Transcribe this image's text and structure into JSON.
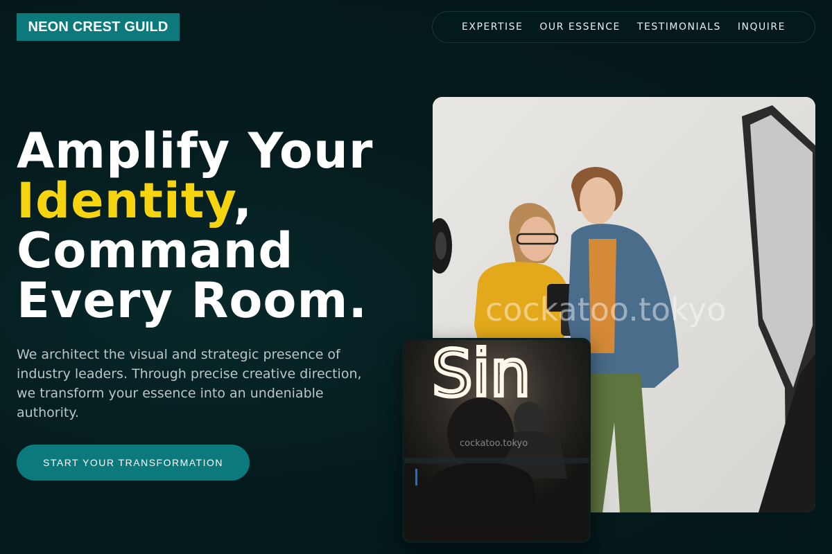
{
  "brand": {
    "name": "NEON CREST GUILD"
  },
  "nav": {
    "items": [
      {
        "label": "EXPERTISE"
      },
      {
        "label": "OUR ESSENCE"
      },
      {
        "label": "TESTIMONIALS"
      },
      {
        "label": "INQUIRE"
      }
    ]
  },
  "hero": {
    "headline_line1": "Amplify Your",
    "headline_accent": "Identity",
    "headline_comma": ",",
    "headline_line3": "Command",
    "headline_line4": "Every Room.",
    "subtext": "We architect the visual and strategic presence of industry leaders. Through precise creative direction, we transform your essence into an undeniable authority.",
    "cta_label": "START YOUR TRANSFORMATION"
  },
  "media": {
    "main_watermark": "cockatoo.tokyo",
    "inset_watermark": "cockatoo.tokyo",
    "inset_neon_text": "Sin"
  },
  "colors": {
    "background": "#031a1c",
    "teal": "#0c7a7c",
    "accent_yellow": "#f6d40f",
    "subtext": "#b9c7c8"
  }
}
